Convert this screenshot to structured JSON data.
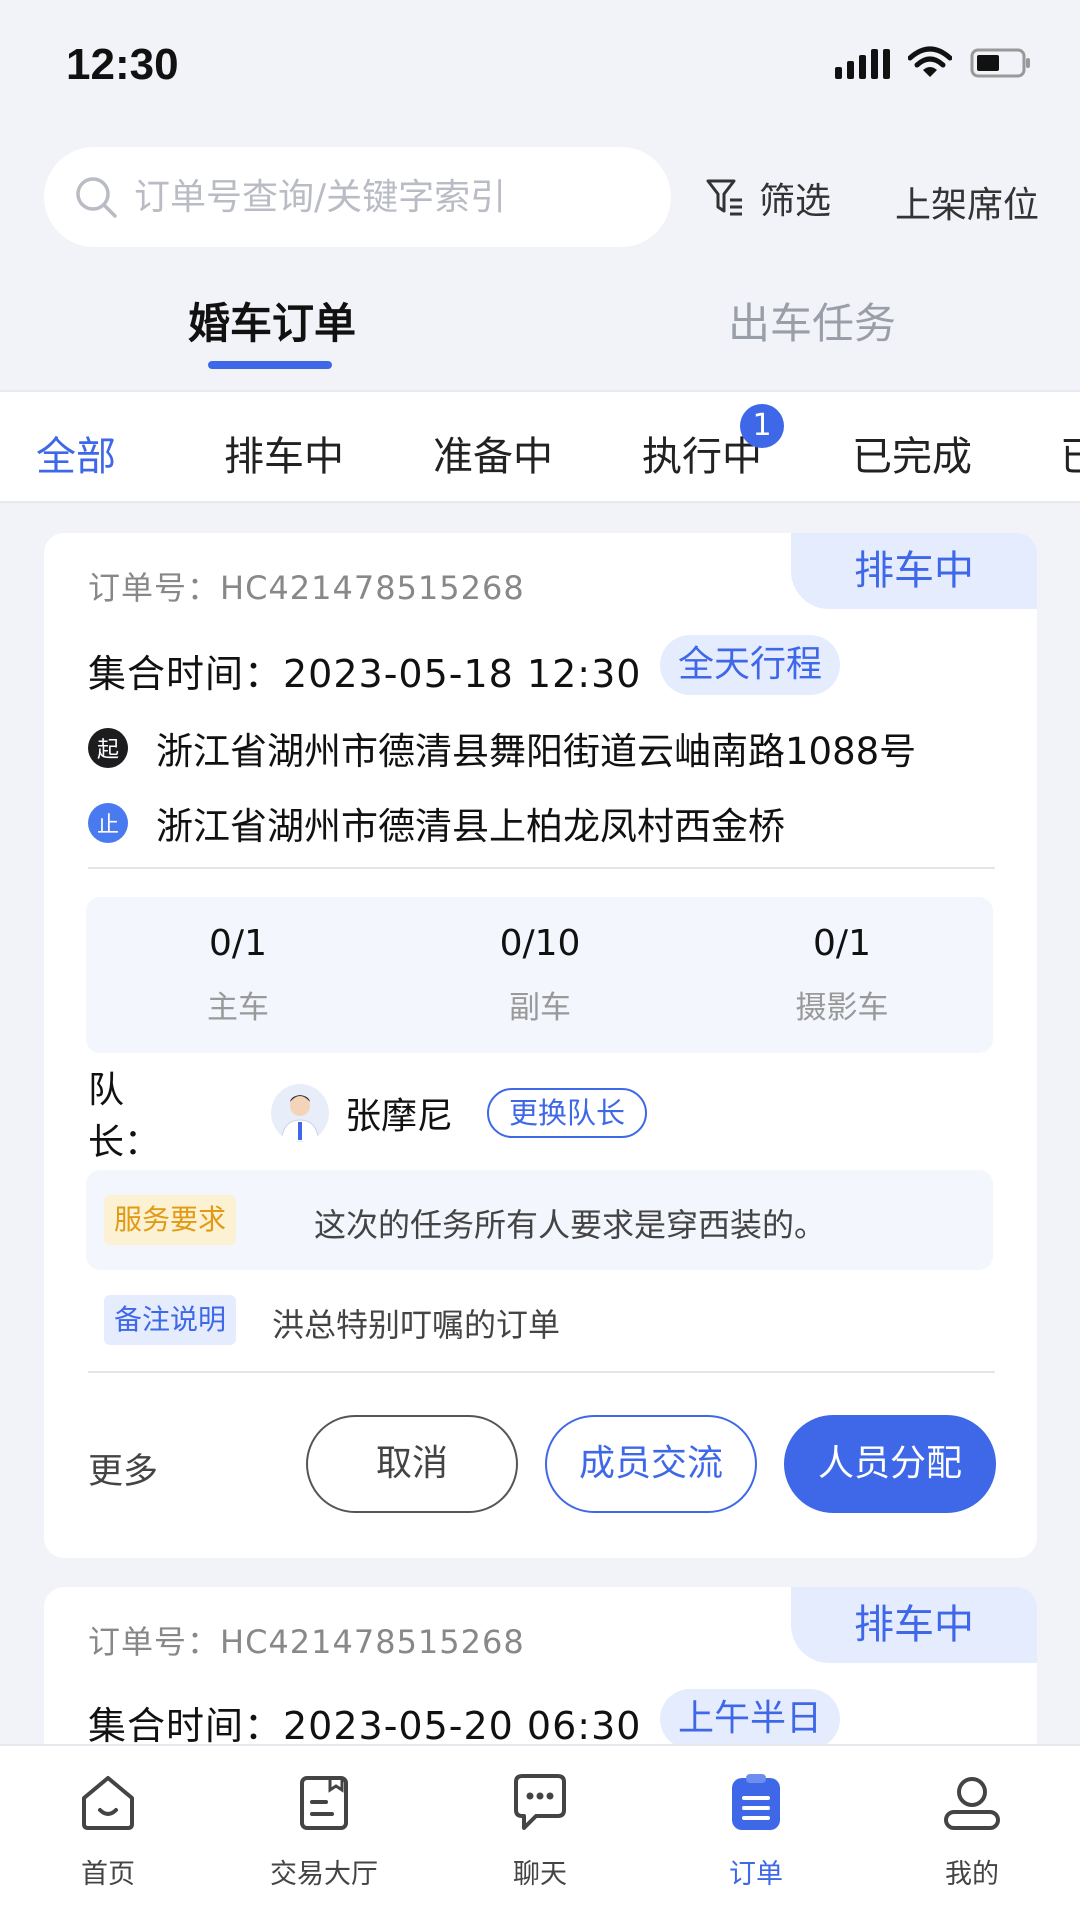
{
  "status_bar": {
    "time": "12:30"
  },
  "header": {
    "search_placeholder": "订单号查询/关键字索引",
    "filter_label": "筛选",
    "list_seat_label": "上架席位"
  },
  "main_tabs": [
    {
      "label": "婚车订单",
      "active": true
    },
    {
      "label": "出车任务",
      "active": false
    }
  ],
  "status_tabs": [
    {
      "label": "全部",
      "active": true
    },
    {
      "label": "排车中"
    },
    {
      "label": "准备中"
    },
    {
      "label": "执行中",
      "badge": "1"
    },
    {
      "label": "已完成"
    },
    {
      "label": "已"
    }
  ],
  "orders": [
    {
      "status": "排车中",
      "order_no": "订单号：HC421478515268",
      "gather_time": "集合时间：2023-05-18 12:30",
      "trip_type": "全天行程",
      "start_marker": "起",
      "start_addr": "浙江省湖州市德清县舞阳街道云岫南路1088号",
      "end_marker": "止",
      "end_addr": "浙江省湖州市德清县上柏龙凤村西金桥",
      "stats": [
        {
          "value": "0/1",
          "label": "主车"
        },
        {
          "value": "0/10",
          "label": "副车"
        },
        {
          "value": "0/1",
          "label": "摄影车"
        }
      ],
      "leader_label_1": "队",
      "leader_label_2": "长：",
      "leader_name": "张摩尼",
      "change_leader": "更换队长",
      "service_tag": "服务要求",
      "service_text": "这次的任务所有人要求是穿西装的。",
      "note_tag": "备注说明",
      "note_text": "洪总特别叮嘱的订单",
      "more": "更多",
      "cancel": "取消",
      "member_chat": "成员交流",
      "assign": "人员分配"
    },
    {
      "status": "排车中",
      "order_no": "订单号：HC421478515268",
      "gather_time": "集合时间：2023-05-20 06:30",
      "trip_type": "上午半日"
    }
  ],
  "bottom_nav": [
    {
      "label": "首页",
      "icon": "home-icon"
    },
    {
      "label": "交易大厅",
      "icon": "trading-hall-icon"
    },
    {
      "label": "聊天",
      "icon": "chat-icon"
    },
    {
      "label": "订单",
      "icon": "order-icon",
      "active": true
    },
    {
      "label": "我的",
      "icon": "profile-icon"
    }
  ],
  "colors": {
    "accent": "#3f68e8",
    "background": "#f1f3f8",
    "service_tag": "#e09b12"
  }
}
